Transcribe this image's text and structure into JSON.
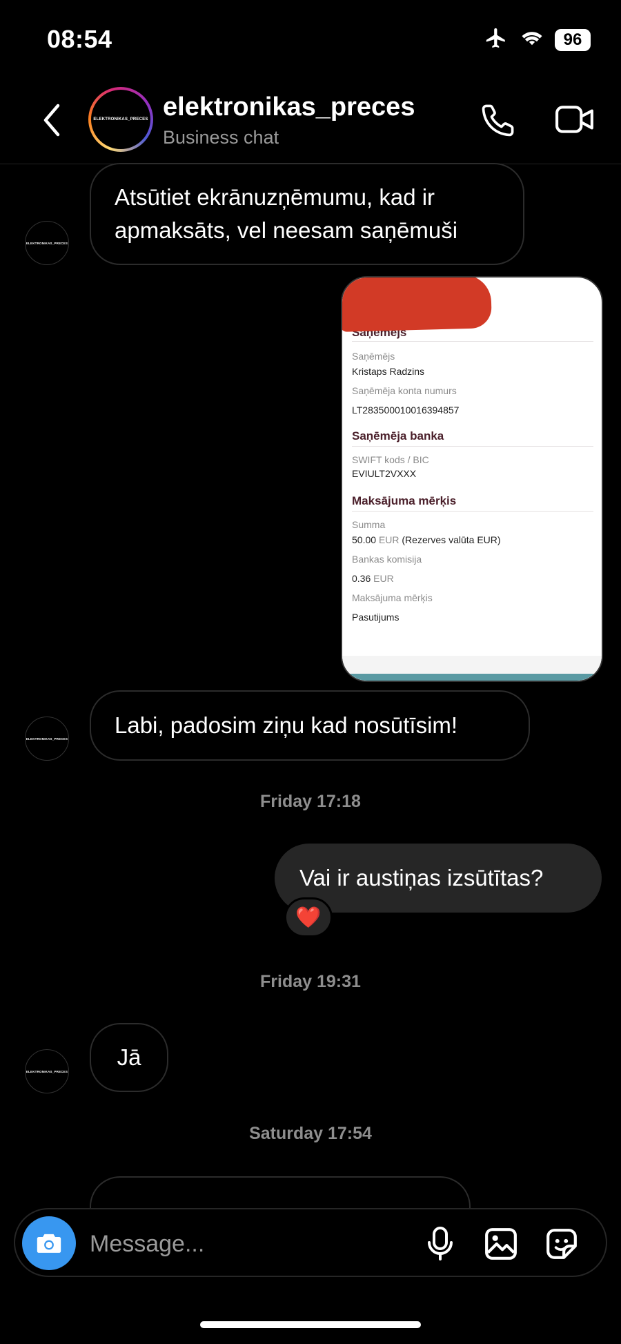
{
  "status_bar": {
    "time": "08:54",
    "battery": "96"
  },
  "header": {
    "username": "elektronikas_preces",
    "subtitle": "Business chat",
    "avatar_text": "ELEKTRONIKAS_PRECES"
  },
  "avatar_small_text": "ELEKTRONIKAS_PRECES",
  "messages": {
    "m1": "Atsūtiet ekrānuzņēmumu, kad ir apmaksāts, vel neesam saņēmuši",
    "m2": "Labi, padosim ziņu kad nosūtīsim!",
    "ts1": "Friday 17:18",
    "m3": "Vai ir austiņas izsūtītas?",
    "reaction": "❤️",
    "ts2": "Friday 19:31",
    "m4": "Jā",
    "ts3": "Saturday 17:54"
  },
  "attachment": {
    "section1": "Saņēmējs",
    "recipient_label": "Saņēmējs",
    "recipient_name": "Kristaps Radzins",
    "account_label": "Saņēmēja konta numurs",
    "account_number": "LT283500010016394857",
    "section2": "Saņēmēja banka",
    "swift_label": "SWIFT kods / BIC",
    "swift_value": "EVIULT2VXXX",
    "section3": "Maksājuma mērķis",
    "amount_label": "Summa",
    "amount_value": "50.00",
    "amount_unit": "EUR",
    "amount_note": "(Rezerves valūta EUR)",
    "fee_label": "Bankas komisija",
    "fee_value": "0.36",
    "fee_unit": "EUR",
    "purpose_label": "Maksājuma mērķis",
    "purpose_value": "Pasutijums"
  },
  "composer": {
    "placeholder": "Message..."
  },
  "colors": {
    "accent": "#3897f0",
    "outgoing_bubble": "#262626",
    "redaction": "#d23a26"
  }
}
